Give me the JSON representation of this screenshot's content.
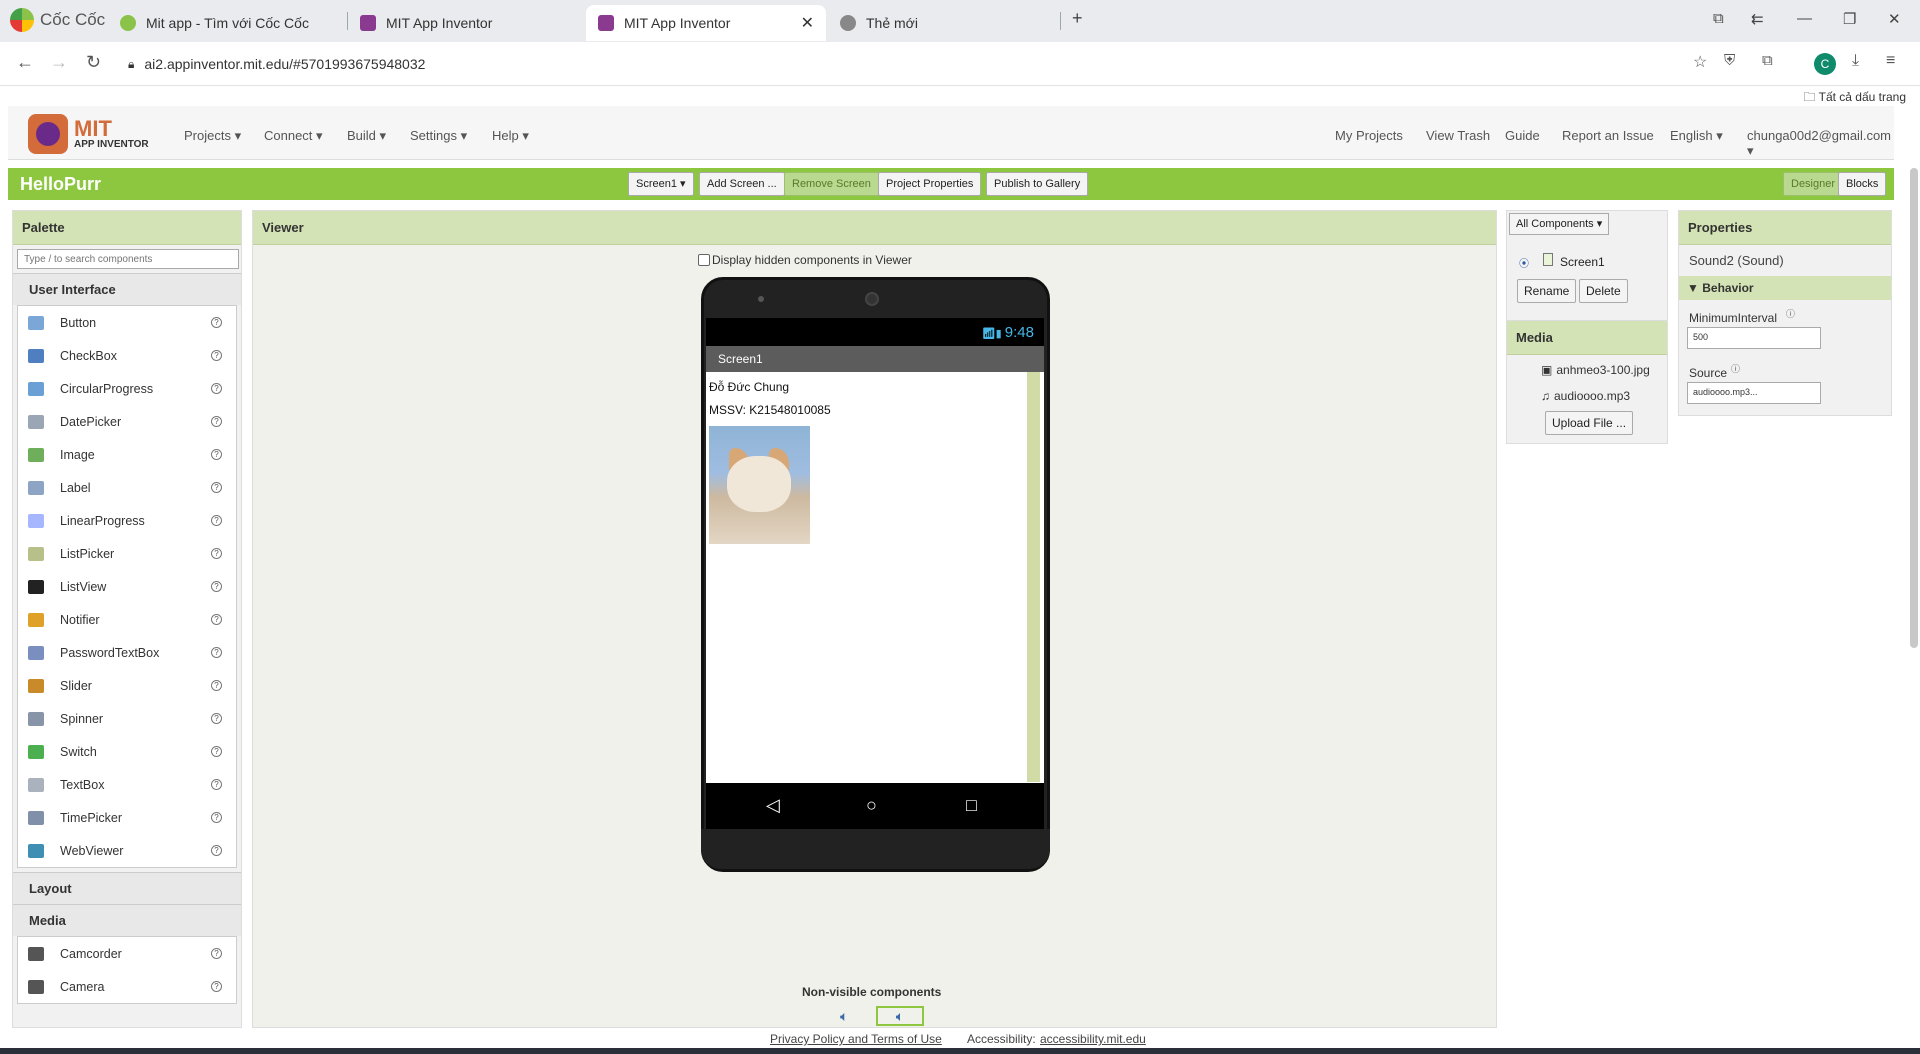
{
  "browser": {
    "brand": "Cốc Cốc",
    "tabs": [
      {
        "title": "Mit app - Tìm với Cốc Cốc"
      },
      {
        "title": "MIT App Inventor"
      },
      {
        "title": "MIT App Inventor"
      },
      {
        "title": "Thẻ mới"
      }
    ],
    "url": "ai2.appinventor.mit.edu/#5701993675948032",
    "bookmarks_label": "Tất cả dấu trang",
    "profile_initial": "C"
  },
  "header": {
    "logo_line1": "MIT",
    "logo_line2": "APP INVENTOR",
    "menus": [
      "Projects ▾",
      "Connect ▾",
      "Build ▾",
      "Settings ▾",
      "Help ▾"
    ],
    "right_links": [
      "My Projects",
      "View Trash",
      "Guide",
      "Report an Issue",
      "English ▾",
      "chunga00d2@gmail.com ▾"
    ]
  },
  "toolbar": {
    "project_name": "HelloPurr",
    "screen_select": "Screen1 ▾",
    "add_screen": "Add Screen ...",
    "remove_screen": "Remove Screen",
    "project_properties": "Project Properties",
    "publish": "Publish to Gallery",
    "designer": "Designer",
    "blocks": "Blocks"
  },
  "palette": {
    "title": "Palette",
    "search_placeholder": "Type / to search components",
    "cat_ui": "User Interface",
    "ui_items": [
      "Button",
      "CheckBox",
      "CircularProgress",
      "DatePicker",
      "Image",
      "Label",
      "LinearProgress",
      "ListPicker",
      "ListView",
      "Notifier",
      "PasswordTextBox",
      "Slider",
      "Spinner",
      "Switch",
      "TextBox",
      "TimePicker",
      "WebViewer"
    ],
    "cat_layout": "Layout",
    "cat_media": "Media",
    "media_items": [
      "Camcorder",
      "Camera"
    ]
  },
  "viewer": {
    "title": "Viewer",
    "hidden_label": "Display hidden components in Viewer",
    "clock": "9:48",
    "screen_title": "Screen1",
    "label1": "Đỗ Đức Chung",
    "label2": "MSSV: K21548010085",
    "nonvisible": "Non-visible components"
  },
  "components": {
    "filter": "All Components ▾",
    "root": "Screen1",
    "rename": "Rename",
    "delete": "Delete"
  },
  "media": {
    "title": "Media",
    "files": [
      "anhmeo3-100.jpg",
      "audioooo.mp3"
    ],
    "upload": "Upload File ..."
  },
  "properties": {
    "title": "Properties",
    "component": "Sound2 (Sound)",
    "group": "Behavior",
    "min_interval_label": "MinimumInterval",
    "min_interval_value": "500",
    "source_label": "Source",
    "source_value": "audioooo.mp3..."
  },
  "footer": {
    "privacy": "Privacy Policy and Terms of Use",
    "accessibility_prefix": "Accessibility:",
    "accessibility_link": "accessibility.mit.edu"
  },
  "colors": {
    "green": "#8dc63f",
    "panel_header": "#d4e3b5"
  }
}
